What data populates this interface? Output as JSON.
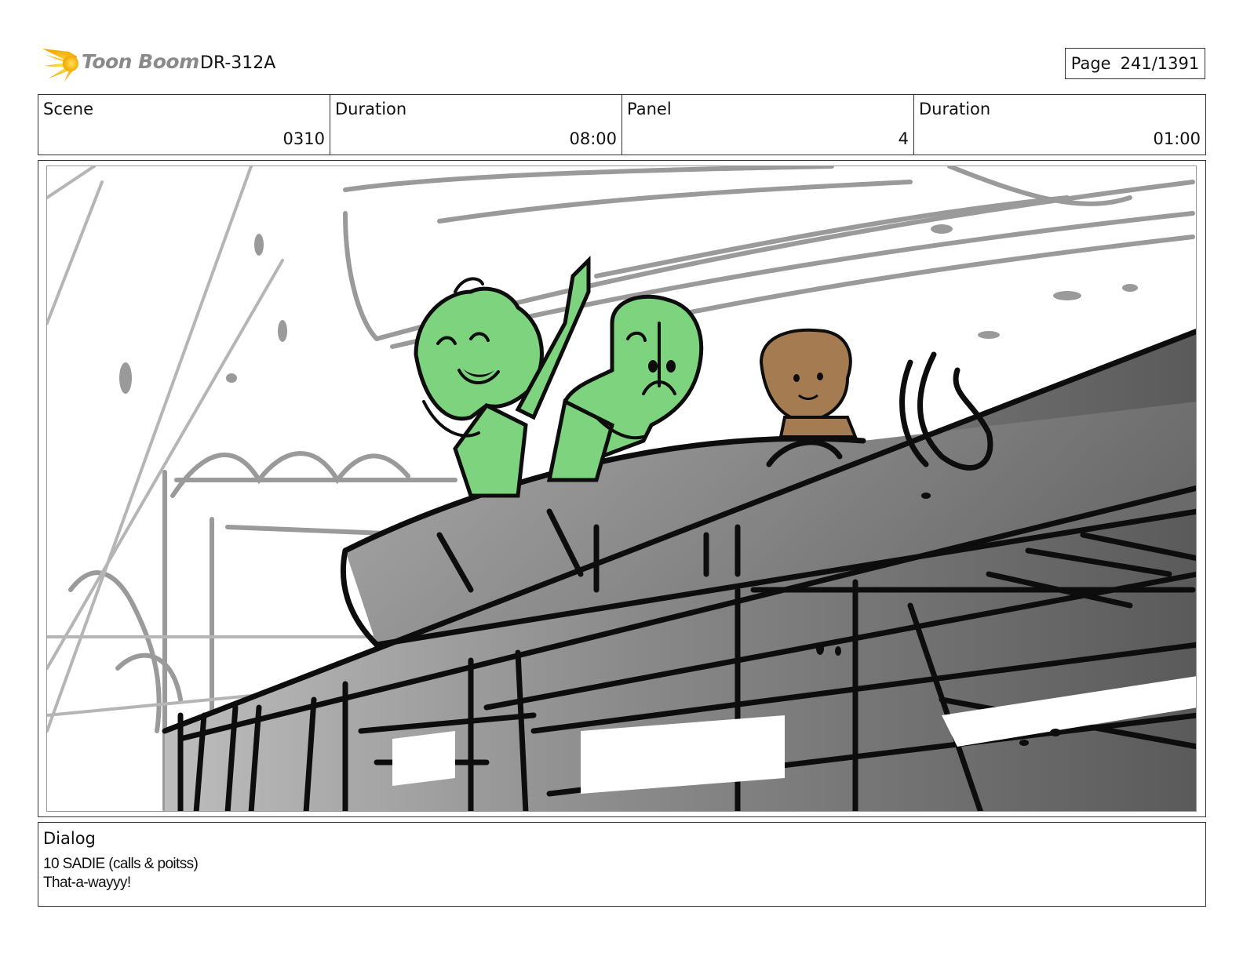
{
  "header": {
    "brand": "Toon Boom",
    "project_code": "DR-312A",
    "page_label": "Page",
    "page_value": "241/1391"
  },
  "info": {
    "scene_label": "Scene",
    "scene_value": "0310",
    "duration_label": "Duration",
    "duration_value": "08:00",
    "panel_label": "Panel",
    "panel_value": "4",
    "panel_duration_label": "Duration",
    "panel_duration_value": "01:00"
  },
  "dialog": {
    "label": "Dialog",
    "line1": "10 SADIE (calls & poitss)",
    "line2": "That-a-wayyy!"
  },
  "colors": {
    "character_green": "#7ed47e",
    "character_brown": "#a57c52",
    "logo_yellow": "#f7c21a",
    "sketch_gray": "#9a9a9a"
  }
}
